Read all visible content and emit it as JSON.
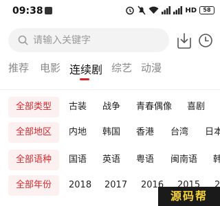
{
  "status_bar": {
    "time": "09:38",
    "network_label": "HD",
    "battery": "58"
  },
  "search": {
    "placeholder": "请输入关键字"
  },
  "tabs": [
    {
      "label": "推荐",
      "active": false
    },
    {
      "label": "电影",
      "active": false
    },
    {
      "label": "连续剧",
      "active": true
    },
    {
      "label": "综艺",
      "active": false
    },
    {
      "label": "动漫",
      "active": false
    }
  ],
  "filters": [
    {
      "label": "全部类型",
      "options": [
        "古装",
        "战争",
        "青春偶像",
        "喜剧"
      ]
    },
    {
      "label": "全部地区",
      "options": [
        "内地",
        "韩国",
        "香港",
        "台湾",
        "日本"
      ]
    },
    {
      "label": "全部语种",
      "options": [
        "国语",
        "英语",
        "粤语",
        "闽南语",
        "韩"
      ]
    },
    {
      "label": "全部年份",
      "options": [
        "2018",
        "2017",
        "2016",
        "2015",
        "2"
      ]
    }
  ],
  "watermark": "源码帮",
  "colors": {
    "accent": "#d02a2f",
    "label_bg": "#fdf0f0",
    "search_bg": "#f3f3f3"
  }
}
